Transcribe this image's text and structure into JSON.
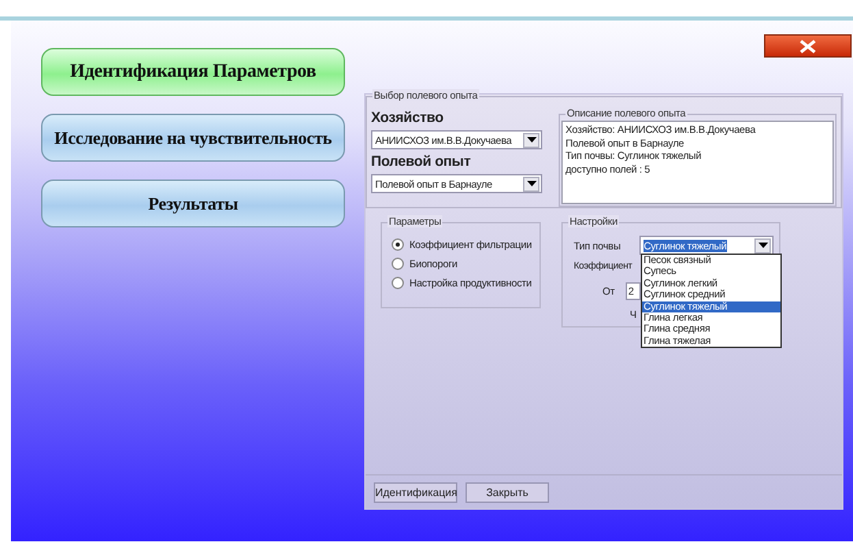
{
  "nav_buttons": [
    {
      "label": "Идентификация Параметров",
      "selected": true
    },
    {
      "label": "Исследование на чувствительность",
      "selected": false
    },
    {
      "label": "Результаты",
      "selected": false
    }
  ],
  "experiment_group": {
    "title": "Выбор полевого опыта",
    "farm_label": "Хозяйство",
    "farm_value": "АНИИСХОЗ им.В.В.Докучаева",
    "experiment_label": "Полевой опыт",
    "experiment_value": "Полевой опыт в Барнауле"
  },
  "description": {
    "title": "Описание полевого опыта",
    "lines": [
      "Хозяйство: АНИИСХОЗ им.В.В.Докучаева",
      "Полевой опыт в Барнауле",
      "Тип почвы: Суглинок тяжелый",
      "доступно полей : 5"
    ]
  },
  "parameters": {
    "title": "Параметры",
    "options": [
      {
        "label": "Коэффициент фильтрации",
        "selected": true
      },
      {
        "label": "Биопороги",
        "selected": false
      },
      {
        "label": "Настройка продуктивности",
        "selected": false
      }
    ]
  },
  "settings": {
    "title": "Настройки",
    "soil_label": "Тип почвы",
    "soil_value": "Суглинок тяжелый",
    "coef_label": "Коэффициент",
    "from_label": "От",
    "from_value": "2",
    "cut_label": "Ч",
    "soil_options": [
      {
        "label": "Песок связный",
        "selected": false
      },
      {
        "label": "Супесь",
        "selected": false
      },
      {
        "label": "Суглинок легкий",
        "selected": false
      },
      {
        "label": "Суглинок средний",
        "selected": false
      },
      {
        "label": "Суглинок тяжелый",
        "selected": true
      },
      {
        "label": "Глина легкая",
        "selected": false
      },
      {
        "label": "Глина средняя",
        "selected": false
      },
      {
        "label": "Глина тяжелая",
        "selected": false
      }
    ]
  },
  "buttons": [
    {
      "label": "Идентификация"
    },
    {
      "label": "Закрыть"
    }
  ]
}
